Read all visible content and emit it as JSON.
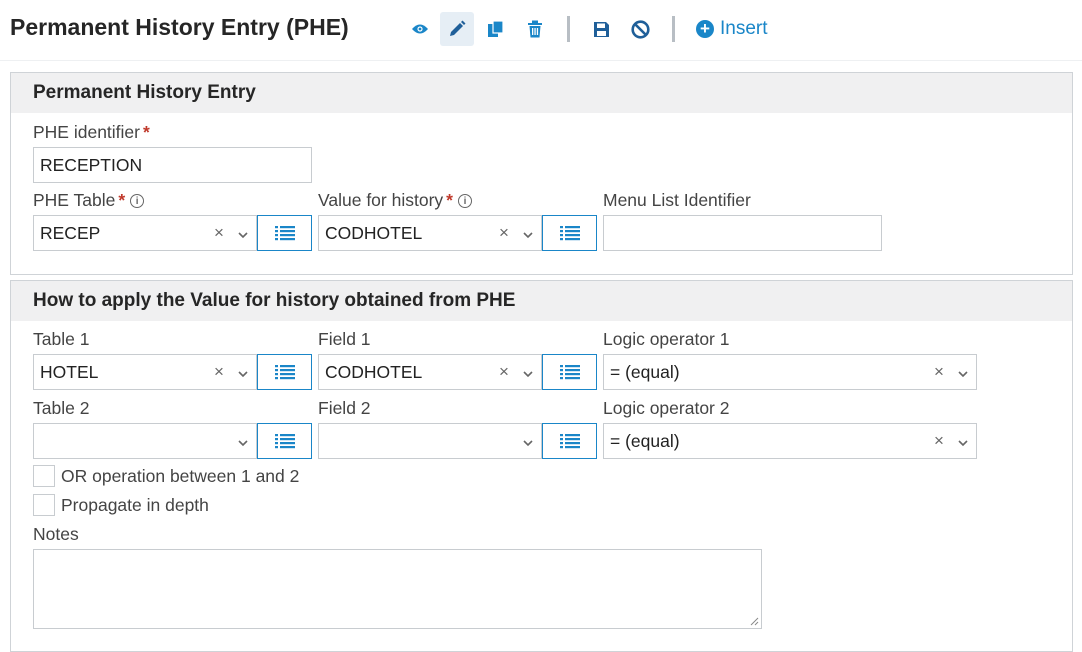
{
  "header": {
    "title": "Permanent History Entry (PHE)",
    "insert_label": "Insert",
    "toolbar_icons": [
      "eye-icon",
      "pencil-icon",
      "copy-icon",
      "trash-icon",
      "save-icon",
      "cancel-icon",
      "plus-circle-icon"
    ]
  },
  "section1": {
    "title": "Permanent History Entry",
    "phe_identifier": {
      "label": "PHE identifier",
      "required": "*",
      "value": "RECEPTION"
    },
    "phe_table": {
      "label": "PHE Table",
      "required": "*",
      "value": "RECEP"
    },
    "value_for_history": {
      "label": "Value for history",
      "required": "*",
      "value": "CODHOTEL"
    },
    "menu_list_identifier": {
      "label": "Menu List Identifier",
      "value": ""
    }
  },
  "section2": {
    "title": "How to apply the Value for history obtained from PHE",
    "table1": {
      "label": "Table 1",
      "value": "HOTEL"
    },
    "field1": {
      "label": "Field 1",
      "value": "CODHOTEL"
    },
    "logic1": {
      "label": "Logic operator 1",
      "value": "= (equal)"
    },
    "table2": {
      "label": "Table 2",
      "value": ""
    },
    "field2": {
      "label": "Field 2",
      "value": ""
    },
    "logic2": {
      "label": "Logic operator 2",
      "value": "= (equal)"
    },
    "or_operation": {
      "label": "OR operation between 1 and 2",
      "checked": false
    },
    "propagate": {
      "label": "Propagate in depth",
      "checked": false
    },
    "notes": {
      "label": "Notes",
      "value": ""
    }
  },
  "colors": {
    "accent": "#1a86c8",
    "required": "#c0392b",
    "section_header_bg": "#f0f0f1"
  }
}
